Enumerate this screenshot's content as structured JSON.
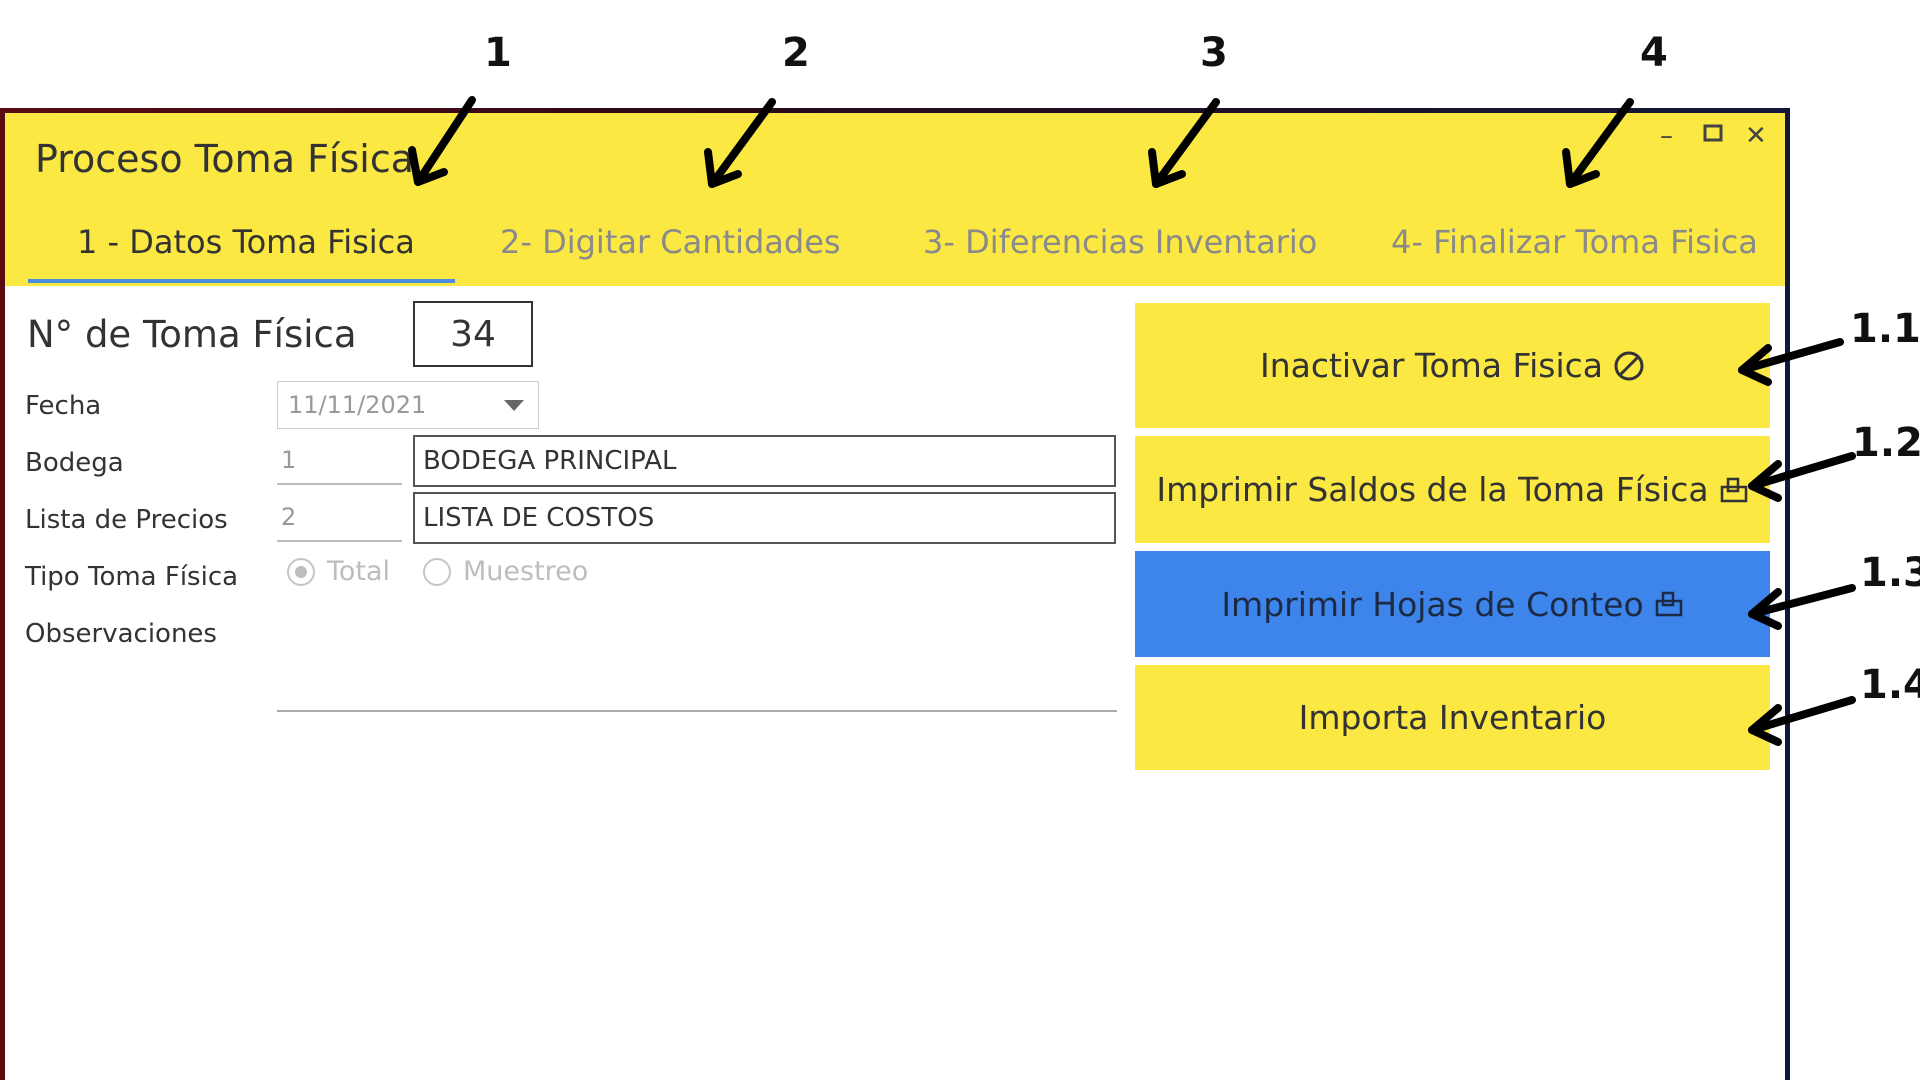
{
  "window": {
    "title": "Proceso Toma Física",
    "controls": {
      "minimize": "–",
      "maximize": "□",
      "close": "✕"
    }
  },
  "tabs": [
    {
      "label": "1 - Datos Toma Fisica",
      "active": true
    },
    {
      "label": "2- Digitar Cantidades",
      "active": false
    },
    {
      "label": "3- Diferencias Inventario",
      "active": false
    },
    {
      "label": "4- Finalizar Toma Fisica",
      "active": false
    }
  ],
  "form": {
    "toma_number_label": "N° de Toma Física",
    "toma_number_value": "34",
    "fecha_label": "Fecha",
    "fecha_value": "11/11/2021",
    "bodega_label": "Bodega",
    "bodega_code": "1",
    "bodega_name": "BODEGA PRINCIPAL",
    "lista_label": "Lista de Precios",
    "lista_code": "2",
    "lista_name": "LISTA DE COSTOS",
    "tipo_label": "Tipo Toma Física",
    "tipo_options": [
      "Total",
      "Muestreo"
    ],
    "tipo_selected": "Total",
    "observaciones_label": "Observaciones",
    "observaciones_value": ""
  },
  "actions": [
    {
      "label": "Inactivar Toma Fisica",
      "icon": "ban-icon",
      "color": "#fbe843"
    },
    {
      "label": "Imprimir Saldos de la Toma Física",
      "icon": "print-icon",
      "color": "#fbe843"
    },
    {
      "label": "Imprimir Hojas de Conteo",
      "icon": "print-icon",
      "color": "#3d85ea"
    },
    {
      "label": "Importa Inventario",
      "icon": "",
      "color": "#fbe843"
    }
  ],
  "annotations": {
    "tabs": [
      "1",
      "2",
      "3",
      "4"
    ],
    "buttons": [
      "1.1",
      "1.2",
      "1.3",
      "1.4"
    ]
  },
  "colors": {
    "header_bg": "#fbe843",
    "active_tab_underline": "#4b8be0",
    "highlight_button": "#3d85ea"
  }
}
